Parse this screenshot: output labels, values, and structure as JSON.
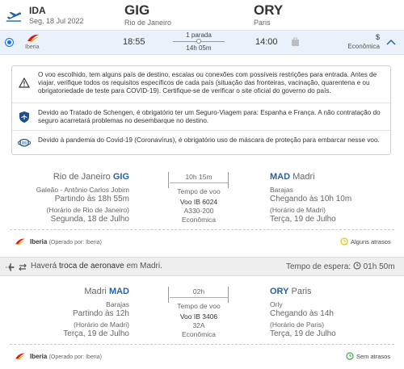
{
  "header": {
    "trip_type": "IDA",
    "date": "Seg, 18 Jul 2022",
    "origin_code": "GIG",
    "origin_city": "Rio de Janeiro",
    "dest_code": "ORY",
    "dest_city": "Paris"
  },
  "option": {
    "airline": "Iberia",
    "depart_time": "18:55",
    "stops": "1 parada",
    "duration": "14h 05m",
    "arrive_time": "14:00",
    "price_symbol": "$",
    "cabin": "Econômica"
  },
  "notices": [
    "O voo escolhido, tem alguns país de destino, escalas ou conexões com possíveis restrições para entrada. Antes de viajar, verifique todos os requisitos específicos de cada país (situação das fronteiras, vacinação, quarentena e ou obrigatoriedade de teste para COVID-19). Certifique-se de verificar o site oficial do governo do país.",
    "Devido ao Tratado de Schengen, é obrigatório ter um Seguro-Viagem para: Espanha e França. A não contratação do seguro acarretará problemas no desembarque no destino.",
    "Devido à pandemia do Covid-19 (Coronavírus), é obrigatório uso de máscara de proteção para embarcar nesse voo."
  ],
  "segment1": {
    "from_city": "Rio de Janeiro",
    "from_code": "GIG",
    "from_airport": "Galeão - Antônio Carlos Jobim",
    "depart_label": "Partindo às",
    "depart_time": "18h 55m",
    "depart_local": "(Horário de Rio de Janeiro)",
    "depart_date_prefix": "Segunda,",
    "depart_date": "18 de Julho",
    "duration": "10h 15m",
    "duration_label": "Tempo de voo",
    "flight": "Voo IB 6024",
    "aircraft": "A330-200",
    "cabin": "Econômica",
    "to_code": "MAD",
    "to_city": "Madri",
    "to_airport": "Barajas",
    "arrive_label": "Chegando às",
    "arrive_time": "10h 10m",
    "arrive_local": "(Horário de Madri)",
    "arrive_date_prefix": "Terça,",
    "arrive_date": "19 de Julho",
    "airline": "Iberia",
    "operated_by": "(Operado por: Iberia)",
    "status": "Alguns atrasos"
  },
  "connection": {
    "text_prefix": "Haverá",
    "text_bold": "troca de aeronave",
    "text_suffix": "em Madri.",
    "wait_label": "Tempo de espera:",
    "wait_time": "01h 50m"
  },
  "segment2": {
    "from_city": "Madri",
    "from_code": "MAD",
    "from_airport": "Barajas",
    "depart_label": "Partindo às",
    "depart_time": "12h",
    "depart_local": "(Horário de Madri)",
    "depart_date_prefix": "Terça,",
    "depart_date": "19 de Julho",
    "duration": "02h",
    "duration_label": "Tempo de voo",
    "flight": "Voo IB 3406",
    "aircraft": "32A",
    "cabin": "Econômica",
    "to_code": "ORY",
    "to_city": "Paris",
    "to_airport": "Orly",
    "arrive_label": "Chegando às",
    "arrive_time": "14h",
    "arrive_local": "(Horário de Paris)",
    "arrive_date_prefix": "Terça,",
    "arrive_date": "19 de Julho",
    "airline": "Iberia",
    "operated_by": "(Operado por: Iberia)",
    "status": "Sem atrasos"
  },
  "colors": {
    "brand_blue": "#2562a8",
    "iberia_red": "#d7192a",
    "iberia_yellow": "#f7b500",
    "delay_yellow": "#f2c200",
    "ok_green": "#3aa655"
  }
}
